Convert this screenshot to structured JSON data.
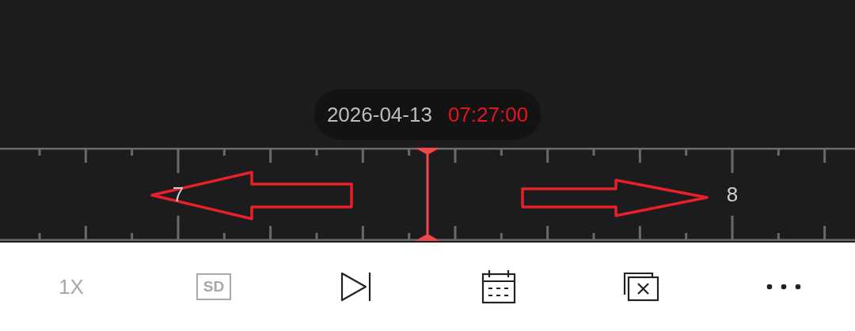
{
  "time_bubble": {
    "date": "2026-04-13",
    "time": "07:27:00"
  },
  "timeline": {
    "labels": [
      "7",
      "8"
    ]
  },
  "toolbar": [
    {
      "kind": "text",
      "label": "1X",
      "disabled": true
    },
    {
      "kind": "boxed",
      "label": "SD",
      "disabled": true
    },
    {
      "kind": "skip",
      "disabled": false
    },
    {
      "kind": "calendar",
      "disabled": false
    },
    {
      "kind": "close-all",
      "disabled": false
    },
    {
      "kind": "more",
      "disabled": false
    }
  ]
}
